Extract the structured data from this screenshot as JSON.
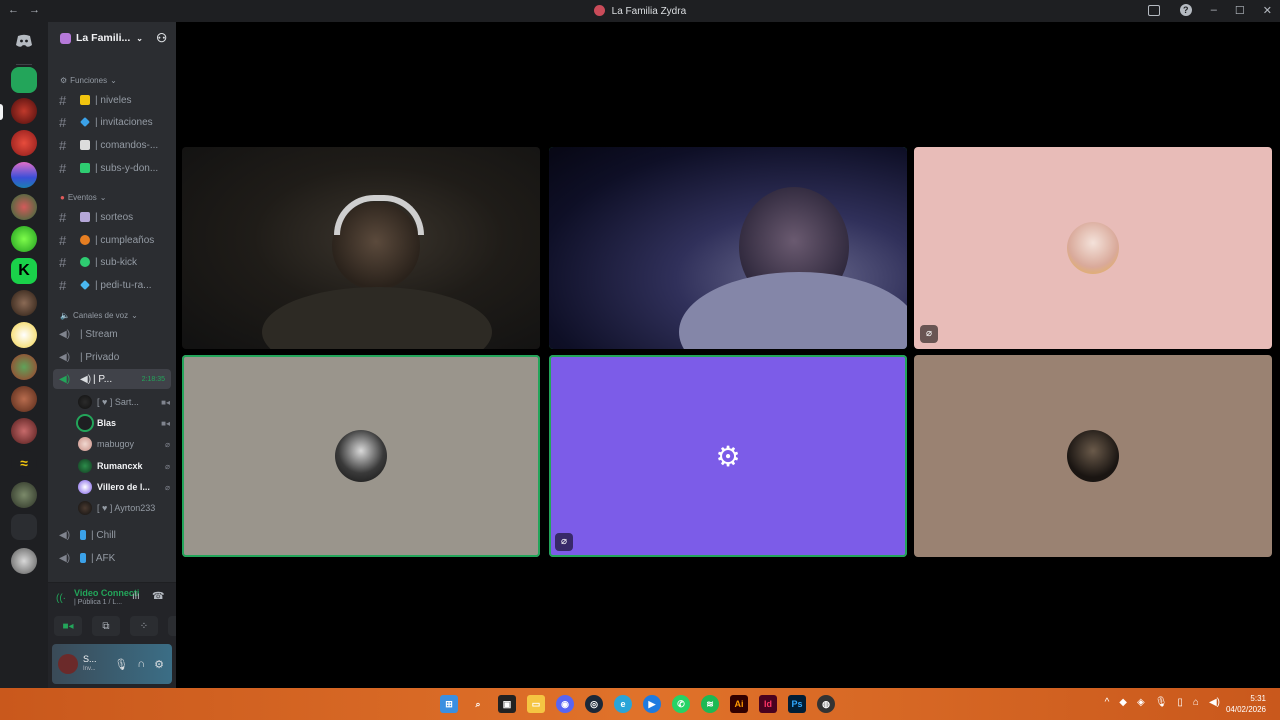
{
  "window": {
    "title": "La Familia Zydra",
    "back_label": "←",
    "forward_label": "→",
    "minimize_label": "–",
    "maximize_label": "☐",
    "close_label": "✕"
  },
  "server": {
    "name": "La Famili...",
    "invite_icon": "add-user-icon"
  },
  "categories": {
    "funciones": "Funciones",
    "eventos": "Eventos",
    "voz": "Canales de voz"
  },
  "channels": {
    "niveles": "| niveles",
    "invitaciones": "| invitaciones",
    "comandos": "| comandos-...",
    "subs": "| subs-y-don...",
    "sorteos": "| sorteos",
    "cumpleanos": "| cumpleaños",
    "subkick": "| sub-kick",
    "pedi": "| pedi-tu-ra...",
    "stream": "| Stream",
    "privado": "| Privado",
    "p": "| P...",
    "p_timer": "2:18:35",
    "chill": "| Chill",
    "afk": "| AFK"
  },
  "voice_users": [
    {
      "name": "[ ♥ ] Sart...",
      "indicator": "■◂"
    },
    {
      "name": "Blas",
      "indicator": "■◂"
    },
    {
      "name": "mabugoy",
      "indicator": "⌀"
    },
    {
      "name": "Rumancxk",
      "indicator": "⌀"
    },
    {
      "name": "Villero de l...",
      "indicator": "⌀"
    },
    {
      "name": "[ ♥ ] Ayrton233",
      "indicator": ""
    }
  ],
  "voice_panel": {
    "status": "Video Connecti",
    "channel": "| Pública 1 / L..."
  },
  "user_panel": {
    "name": "S...",
    "status": "Inv..."
  },
  "taskbar": {
    "time": "5:31",
    "date": "04/02/2026"
  },
  "colors": {
    "speaking": "#23a55a",
    "tile_pink": "#e8bcb8",
    "tile_gray": "#9a958c",
    "tile_purple": "#7c5ce8",
    "tile_brown": "#9a8272",
    "taskbar": "#d8662a"
  }
}
